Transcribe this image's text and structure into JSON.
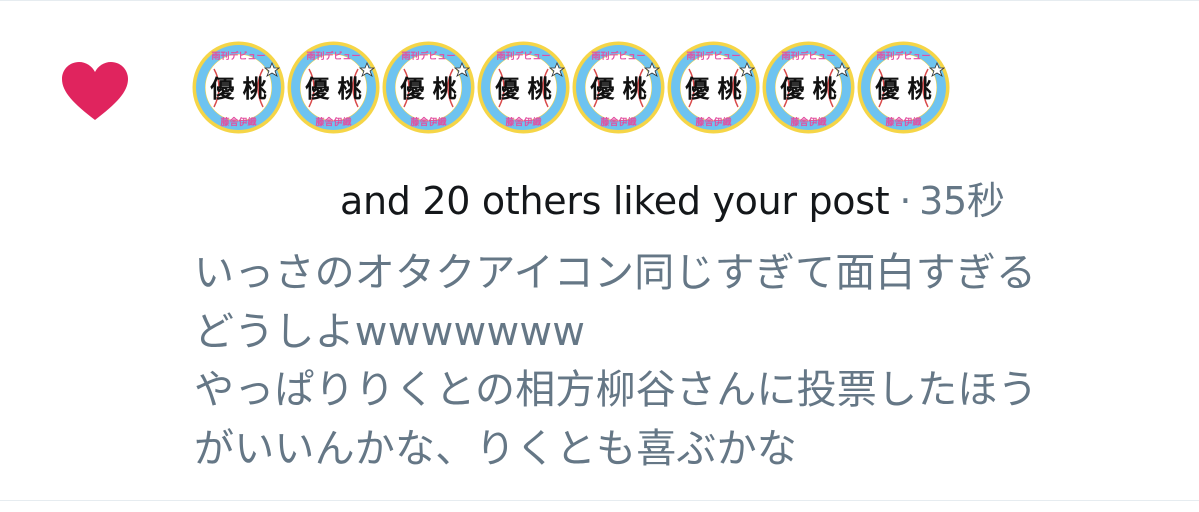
{
  "like_icon": {
    "name": "heart-icon",
    "color": "#e0245e"
  },
  "avatars": {
    "icon": "avatar-badge",
    "count_shown": 8,
    "badge_text_top": "雨刊デビュー",
    "badge_text_main": "優 桃",
    "badge_text_bottom": "藤舎伊織",
    "colors": {
      "ring": "#f5d547",
      "inner_ring": "#6ec3f0",
      "center": "#ffffff"
    }
  },
  "notification": {
    "text": "and 20 others liked your post",
    "separator": "·",
    "time": "35秒"
  },
  "tweet": {
    "lines": [
      "いっさのオタクアイコン同じすぎて面白すぎる",
      "どうしよwwwwwww",
      "やっぱりりくとの相方柳谷さんに投票したほう",
      "がいいんかな、りくとも喜ぶかな"
    ]
  },
  "colors": {
    "primary_text": "#14171a",
    "secondary_text": "#657786",
    "divider": "#e6ecf0"
  }
}
